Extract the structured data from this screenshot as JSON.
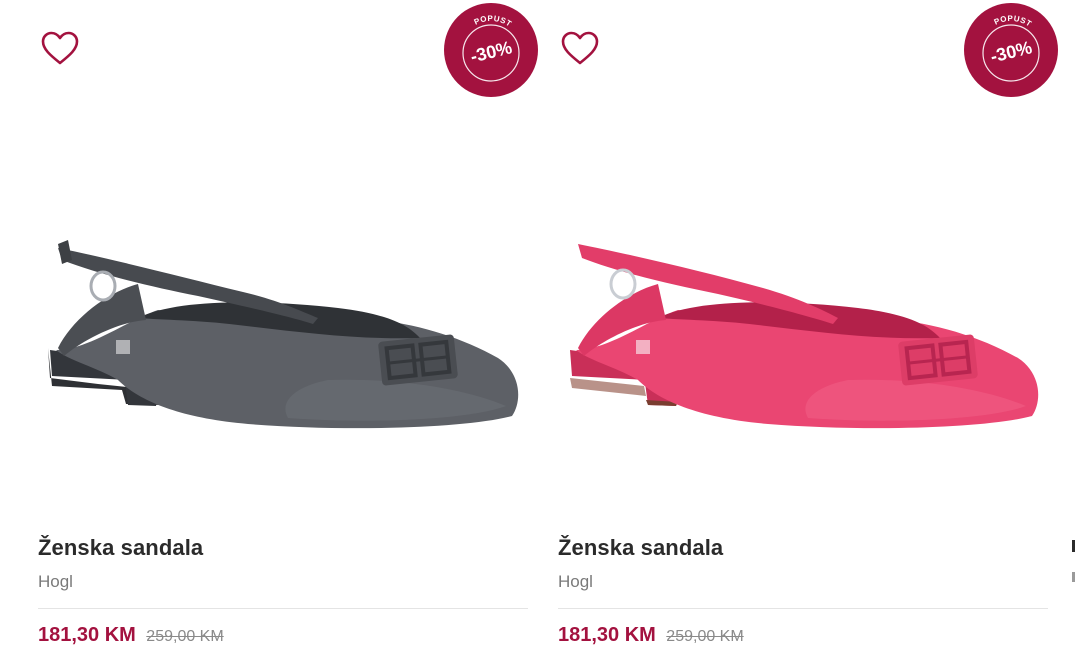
{
  "products": [
    {
      "title": "Ženska sandala",
      "brand": "Hogl",
      "price_current": "181,30 KM",
      "price_old": "259,00 KM",
      "discount_label": "POPUST",
      "discount_value": "-30%",
      "shoe_color": "#54575c",
      "icons": {
        "wishlist": "heart-outline-icon"
      }
    },
    {
      "title": "Ženska sandala",
      "brand": "Hogl",
      "price_current": "181,30 KM",
      "price_old": "259,00 KM",
      "discount_label": "POPUST",
      "discount_value": "-30%",
      "shoe_color": "#e8406e",
      "icons": {
        "wishlist": "heart-outline-icon"
      }
    }
  ],
  "colors": {
    "accent": "#a3123f",
    "title": "#2b2b2b",
    "muted": "#7a7a7a"
  }
}
